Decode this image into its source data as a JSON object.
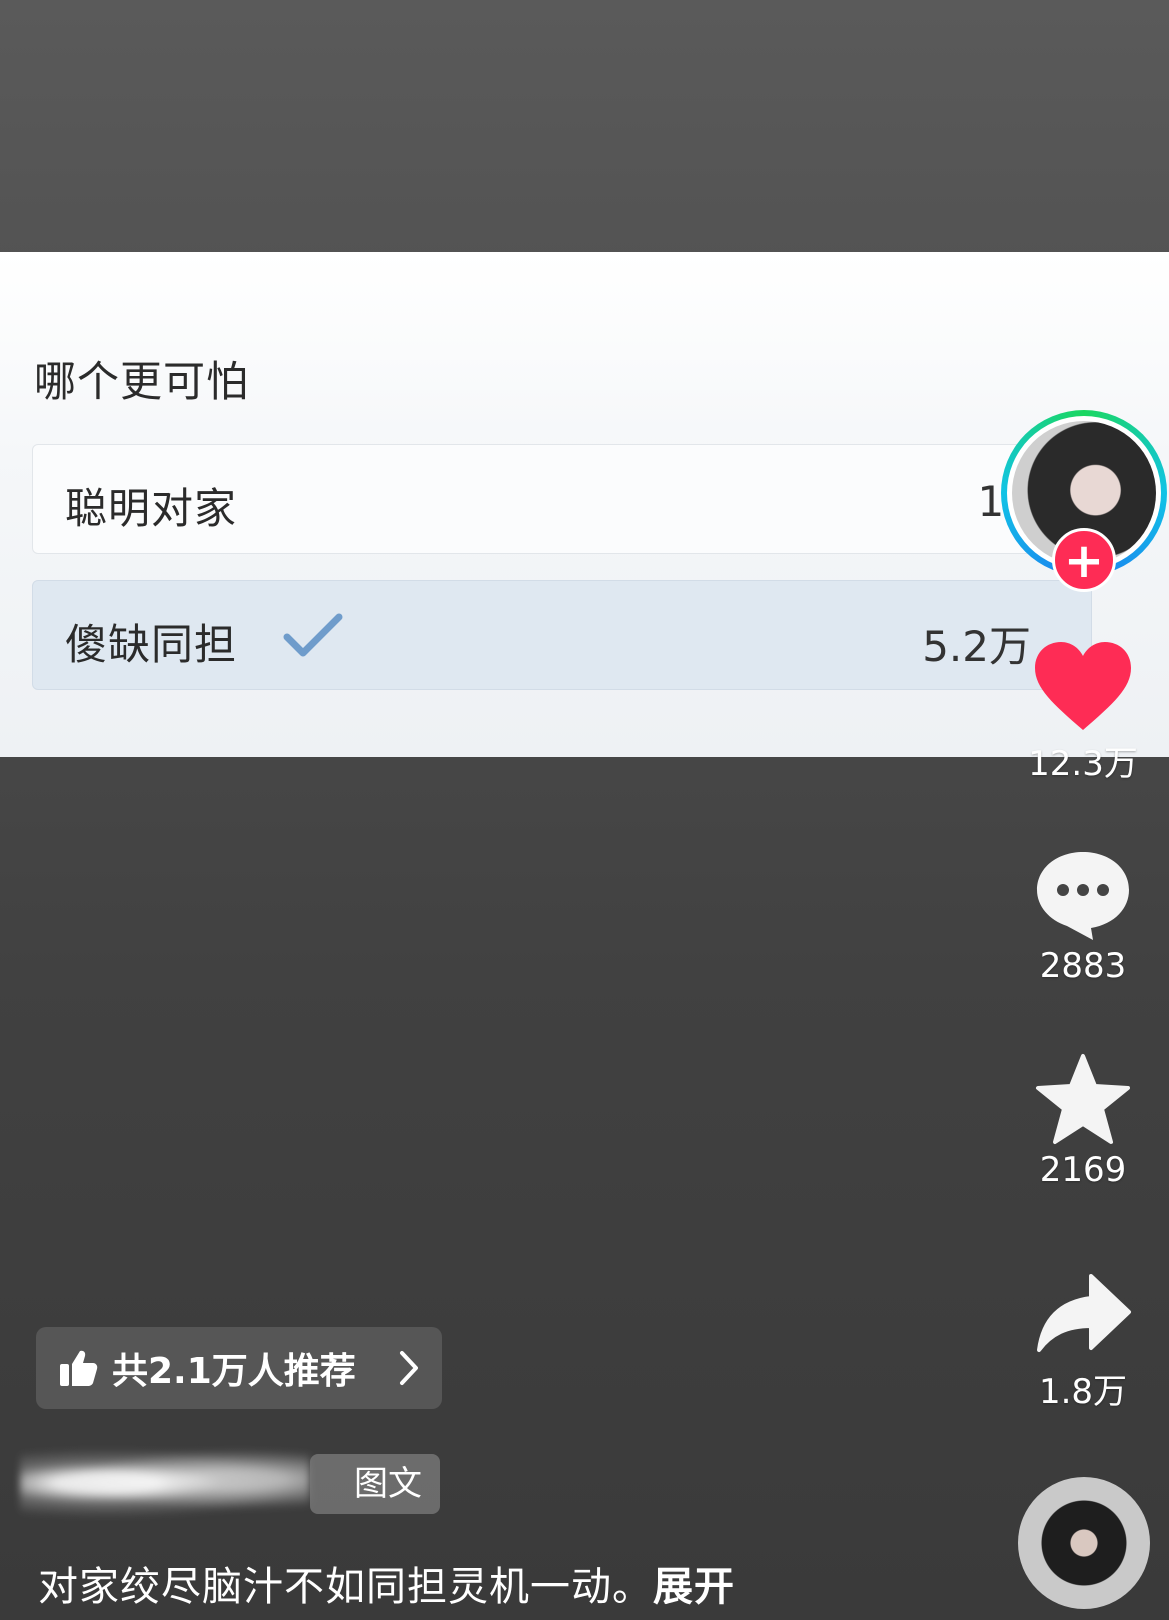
{
  "poll": {
    "question": "哪个更可怕",
    "options": [
      {
        "label": "聪明对家",
        "count": "13",
        "selected": false
      },
      {
        "label": "傻缺同担",
        "count": "5.2万",
        "selected": true
      }
    ]
  },
  "actions": {
    "follow_symbol": "+",
    "like_count": "12.3万",
    "comment_count": "2883",
    "favorite_count": "2169",
    "share_count": "1.8万"
  },
  "recommend": {
    "text": "共2.1万人推荐"
  },
  "post": {
    "type_tag": "图文",
    "caption": "对家绞尽脑汁不如同担灵机一动。",
    "expand_label": "展开"
  },
  "colors": {
    "accent_red": "#fe2c55",
    "check_blue": "#6f9ccb"
  }
}
